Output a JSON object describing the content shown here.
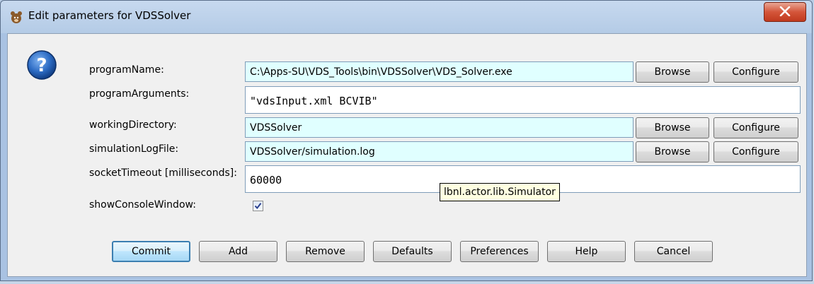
{
  "window": {
    "title": "Edit parameters for VDSSolver",
    "title_icon": "bear-icon",
    "close_icon": "close-x-icon"
  },
  "icons": {
    "help": "question-mark-icon",
    "check": "checkmark-icon"
  },
  "colors": {
    "field_bg": "#e0ffff",
    "tooltip_bg": "#ffffe1",
    "close_red": "#c03a1e",
    "focus_blue": "#3c7fb1"
  },
  "params": {
    "program_name": {
      "label": "programName:",
      "value": "C:\\Apps-SU\\VDS_Tools\\bin\\VDSSolver\\VDS_Solver.exe"
    },
    "program_arguments": {
      "label": "programArguments:",
      "value": "\"vdsInput.xml BCVIB\""
    },
    "working_directory": {
      "label": "workingDirectory:",
      "value": "VDSSolver"
    },
    "simulation_log_file": {
      "label": "simulationLogFile:",
      "value": "VDSSolver/simulation.log"
    },
    "socket_timeout": {
      "label": "socketTimeout [milliseconds]:",
      "value": "60000"
    },
    "show_console_window": {
      "label": "showConsoleWindow:",
      "checked": true
    }
  },
  "row_buttons": {
    "browse": "Browse",
    "configure": "Configure"
  },
  "tooltip": {
    "text": "lbnl.actor.lib.Simulator"
  },
  "footer_buttons": {
    "commit": "Commit",
    "add": "Add",
    "remove": "Remove",
    "defaults": "Defaults",
    "preferences": "Preferences",
    "help": "Help",
    "cancel": "Cancel"
  }
}
